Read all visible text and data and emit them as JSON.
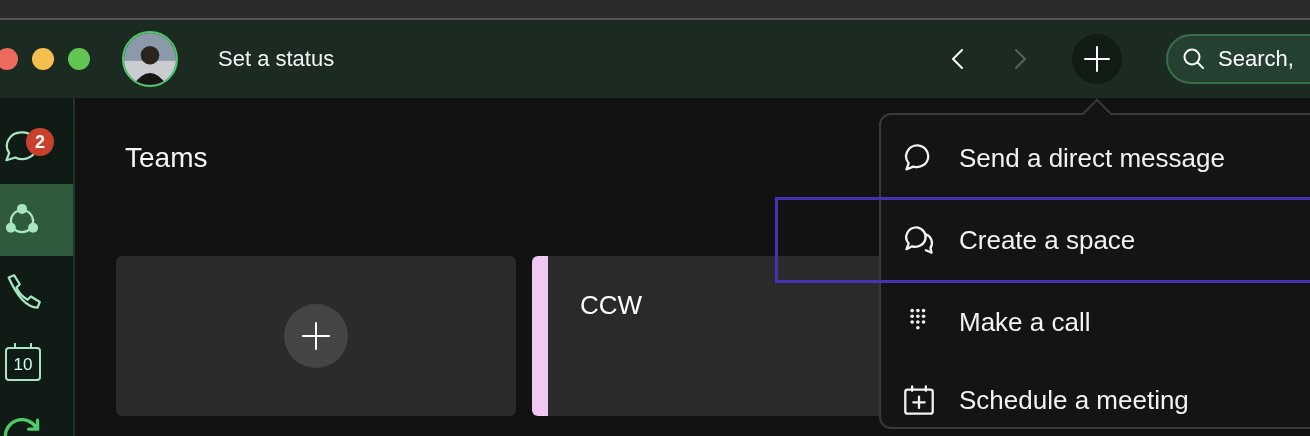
{
  "header": {
    "status_prompt": "Set a status",
    "nav": [
      {
        "kind": "back",
        "disabled": false
      },
      {
        "kind": "forward",
        "disabled": true
      }
    ],
    "search": {
      "placeholder": "Search,"
    }
  },
  "sidebar": {
    "items": [
      {
        "kind": "messaging",
        "selected": false,
        "badge": "2"
      },
      {
        "kind": "teams",
        "selected": true
      },
      {
        "kind": "calling",
        "selected": false
      },
      {
        "kind": "meetings",
        "selected": false,
        "label": "10"
      },
      {
        "kind": "updates",
        "selected": false
      }
    ]
  },
  "main": {
    "title": "Teams",
    "cards": [
      {
        "kind": "add"
      },
      {
        "kind": "team",
        "name": "CCW",
        "color": "#f0c8f2"
      }
    ]
  },
  "menu": {
    "items": [
      {
        "kind": "message",
        "label": "Send a direct message",
        "highlighted": false
      },
      {
        "kind": "space",
        "label": "Create a space",
        "highlighted": true
      },
      {
        "kind": "call",
        "label": "Make a call",
        "highlighted": false
      },
      {
        "kind": "meeting",
        "label": "Schedule a meeting",
        "highlighted": false
      }
    ]
  }
}
